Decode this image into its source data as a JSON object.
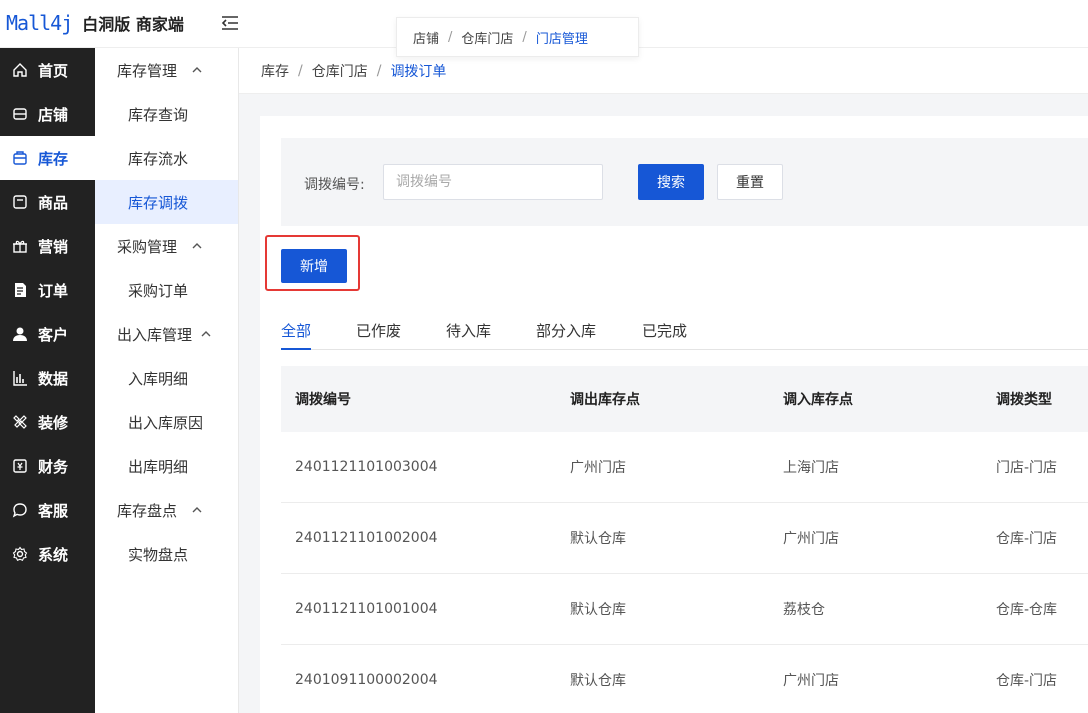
{
  "app": {
    "brand": "Mall4j",
    "edition": "白洞版 商家端"
  },
  "tab_popup": {
    "items": [
      "店铺",
      "仓库门店"
    ],
    "current": "门店管理"
  },
  "nav1": {
    "items": [
      {
        "label": "首页",
        "icon": "home-icon"
      },
      {
        "label": "店铺",
        "icon": "shop-icon"
      },
      {
        "label": "库存",
        "icon": "inventory-icon",
        "active": true
      },
      {
        "label": "商品",
        "icon": "product-icon"
      },
      {
        "label": "营销",
        "icon": "gift-icon"
      },
      {
        "label": "订单",
        "icon": "order-icon"
      },
      {
        "label": "客户",
        "icon": "user-icon"
      },
      {
        "label": "数据",
        "icon": "chart-icon"
      },
      {
        "label": "装修",
        "icon": "decorate-icon"
      },
      {
        "label": "财务",
        "icon": "finance-icon"
      },
      {
        "label": "客服",
        "icon": "chat-icon"
      },
      {
        "label": "系统",
        "icon": "settings-icon"
      }
    ]
  },
  "nav2": {
    "g1": "库存管理",
    "g1_items": [
      "库存查询",
      "库存流水",
      "库存调拨"
    ],
    "g2": "采购管理",
    "g2_items": [
      "采购订单"
    ],
    "g3": "出入库管理",
    "g3_items": [
      "入库明细",
      "出入库原因",
      "出库明细"
    ],
    "g4": "库存盘点",
    "g4_items": [
      "实物盘点"
    ]
  },
  "breadcrumb": {
    "items": [
      "库存",
      "仓库门店"
    ],
    "current": "调拨订单"
  },
  "search": {
    "label": "调拨编号:",
    "placeholder": "调拨编号",
    "search_btn": "搜索",
    "reset_btn": "重置"
  },
  "add_btn": "新增",
  "tabs": [
    "全部",
    "已作废",
    "待入库",
    "部分入库",
    "已完成"
  ],
  "table": {
    "headers": [
      "调拨编号",
      "调出库存点",
      "调入库存点",
      "调拨类型"
    ],
    "rows": [
      [
        "2401121101003004",
        "广州门店",
        "上海门店",
        "门店-门店"
      ],
      [
        "2401121101002004",
        "默认仓库",
        "广州门店",
        "仓库-门店"
      ],
      [
        "2401121101001004",
        "默认仓库",
        "荔枝仓",
        "仓库-仓库"
      ],
      [
        "2401091100002004",
        "默认仓库",
        "广州门店",
        "仓库-门店"
      ]
    ]
  },
  "colors": {
    "accent": "#1657d6",
    "sidebar": "#222222",
    "highlight": "#e53935"
  }
}
